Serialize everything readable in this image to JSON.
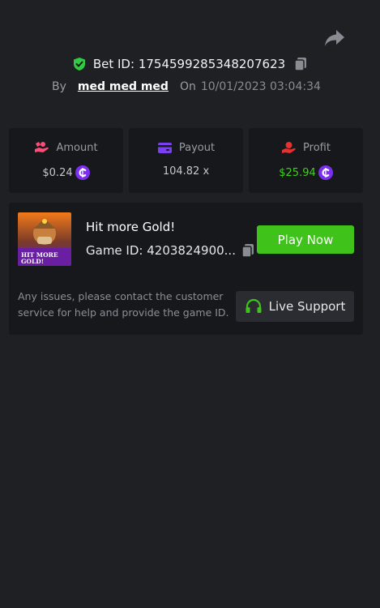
{
  "bet": {
    "label": "Bet ID:",
    "id": "1754599285348207623"
  },
  "meta": {
    "by_label": "By",
    "username": "med med med",
    "on_label": "On",
    "datetime": "10/01/2023 03:04:34"
  },
  "stats": {
    "amount": {
      "label": "Amount",
      "value": "$0.24"
    },
    "payout": {
      "label": "Payout",
      "value": "104.82 x"
    },
    "profit": {
      "label": "Profit",
      "value": "$25.94"
    }
  },
  "game": {
    "name": "Hit more Gold!",
    "id_label": "Game ID:",
    "id": "4203824900...",
    "thumb_text": "HIT MORE GOLD!",
    "play_label": "Play Now"
  },
  "support": {
    "help_text": "Any issues, please contact the customer service for help and provide the game ID.",
    "button_label": "Live Support"
  },
  "colors": {
    "background": "#1f2024",
    "card": "#17181b",
    "accent_green": "#3fc31b",
    "profit_green": "#3fd11d",
    "coin_purple": "#7b2ff0",
    "shield_green": "#2ecc40",
    "payout_purple": "#7b3ff2",
    "amount_pink": "#ff4d7a",
    "profit_red": "#e8312f"
  },
  "icons": {
    "share": "share-icon",
    "verified": "shield-check-icon",
    "copy": "copy-icon",
    "amount": "hand-coins-icon",
    "payout": "wallet-card-icon",
    "profit": "hand-money-icon",
    "coin": "coin-icon",
    "support": "headset-icon"
  }
}
